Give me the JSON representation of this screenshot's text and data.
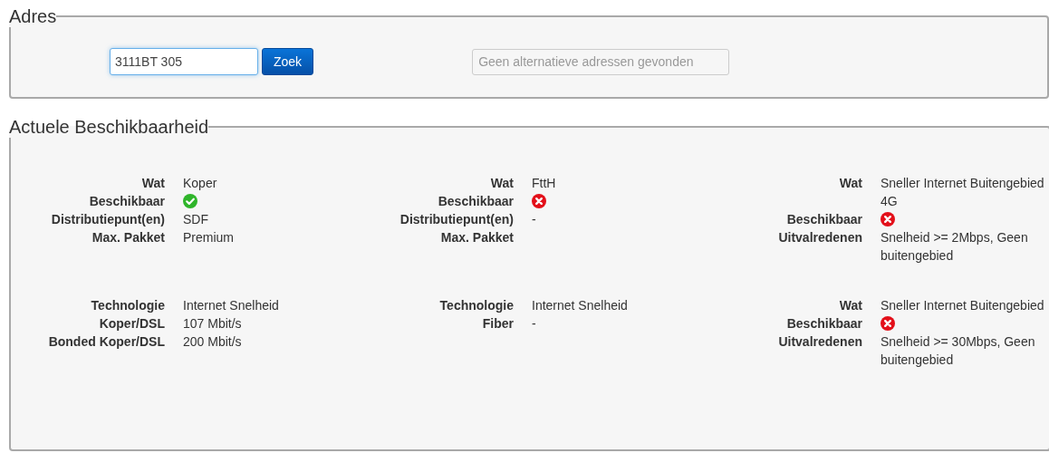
{
  "address": {
    "legend": "Adres",
    "input": {
      "value": "3111BT 305"
    },
    "button": "Zoek",
    "alternatives": {
      "placeholder": "Geen alternatieve adressen gevonden"
    }
  },
  "availability": {
    "legend": "Actuele Beschikbaarheid",
    "blocks": [
      {
        "rows": [
          {
            "kind": "text",
            "label": "Wat",
            "value": "Koper"
          },
          {
            "kind": "status",
            "label": "Beschikbaar",
            "available": true
          },
          {
            "kind": "text",
            "label": "Distributiepunt(en)",
            "value": "SDF"
          },
          {
            "kind": "text",
            "label": "Max. Pakket",
            "value": "Premium"
          }
        ]
      },
      {
        "rows": [
          {
            "kind": "text",
            "label": "Wat",
            "value": "FttH"
          },
          {
            "kind": "status",
            "label": "Beschikbaar",
            "available": false
          },
          {
            "kind": "text",
            "label": "Distributiepunt(en)",
            "value": "-"
          },
          {
            "kind": "text",
            "label": "Max. Pakket"
          }
        ]
      },
      {
        "rows": [
          {
            "kind": "text",
            "label": "Wat",
            "value": "Sneller Internet Buitengebied 4G"
          },
          {
            "kind": "status",
            "label": "Beschikbaar",
            "available": false
          },
          {
            "kind": "text",
            "label": "Uitvalredenen",
            "value": "Snelheid >= 2Mbps, Geen buitengebied"
          }
        ]
      },
      {
        "rows": [
          {
            "kind": "text",
            "label": "Technologie",
            "value": "Internet Snelheid"
          },
          {
            "kind": "text",
            "label": "Koper/DSL",
            "value": "107 Mbit/s"
          },
          {
            "kind": "text",
            "label": "Bonded Koper/DSL",
            "value": "200 Mbit/s"
          }
        ]
      },
      {
        "rows": [
          {
            "kind": "text",
            "label": "Technologie",
            "value": "Internet Snelheid"
          },
          {
            "kind": "text",
            "label": "Fiber",
            "value": "-"
          }
        ]
      },
      {
        "rows": [
          {
            "kind": "text",
            "label": "Wat",
            "value": "Sneller Internet Buitengebied"
          },
          {
            "kind": "status",
            "label": "Beschikbaar",
            "available": false
          },
          {
            "kind": "text",
            "label": "Uitvalredenen",
            "value": "Snelheid >= 30Mbps, Geen buitengebied"
          }
        ]
      }
    ]
  }
}
